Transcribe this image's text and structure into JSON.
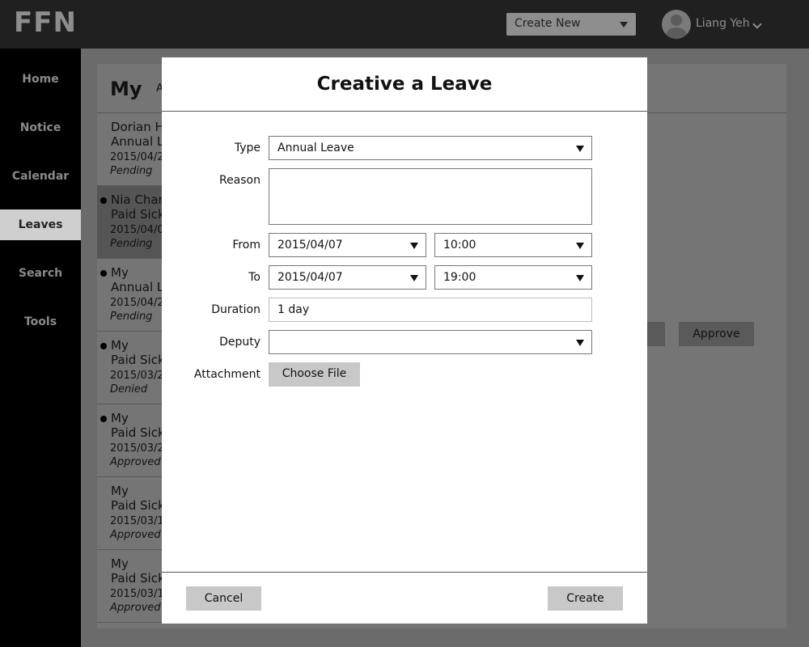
{
  "header": {
    "logo": "FFN",
    "create_new_label": "Create New",
    "user_name": "Liang Yeh"
  },
  "sidebar": {
    "items": [
      {
        "label": "Home"
      },
      {
        "label": "Notice"
      },
      {
        "label": "Calendar"
      },
      {
        "label": "Leaves",
        "active": true
      },
      {
        "label": "Search"
      },
      {
        "label": "Tools"
      }
    ]
  },
  "background": {
    "title": "My",
    "subtitle": "A",
    "list": [
      {
        "line1": "Dorian H",
        "line2": "Annual L",
        "date": "2015/04/2",
        "status": "Pending"
      },
      {
        "line1": "Nia Char",
        "line2": "Paid Sick",
        "date": "2015/04/0",
        "status": "Pending"
      },
      {
        "line1": "My",
        "line2": "Annual L",
        "date": "2015/04/2",
        "status": "Pending"
      },
      {
        "line1": "My",
        "line2": "Paid Sick",
        "date": "2015/03/2",
        "status": "Denied"
      },
      {
        "line1": "My",
        "line2": "Paid Sick",
        "date": "2015/03/2",
        "status": "Approved"
      },
      {
        "line1": "My",
        "line2": "Paid Sick",
        "date": "2015/03/1",
        "status": "Approved"
      },
      {
        "line1": "My",
        "line2": "Paid Sick",
        "date": "2015/03/1",
        "status": "Approved"
      }
    ],
    "approve_label": "Approve"
  },
  "modal": {
    "title": "Creative a Leave",
    "type_label": "Type",
    "type_value": "Annual Leave",
    "reason_label": "Reason",
    "reason_value": "",
    "from_label": "From",
    "from_date": "2015/04/07",
    "from_time": "10:00",
    "to_label": "To",
    "to_date": "2015/04/07",
    "to_time": "19:00",
    "duration_label": "Duration",
    "duration_value": "1 day",
    "deputy_label": "Deputy",
    "deputy_value": "",
    "attachment_label": "Attachment",
    "choose_file_label": "Choose File",
    "cancel_label": "Cancel",
    "create_label": "Create"
  }
}
